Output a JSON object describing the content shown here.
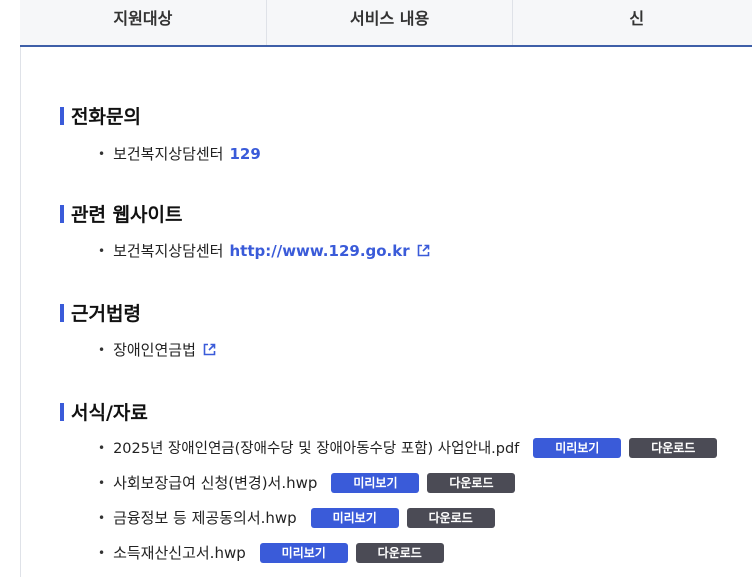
{
  "tabs": [
    "지원대상",
    "서비스 내용",
    "신"
  ],
  "sections": {
    "phone": {
      "title": "전화문의",
      "item_label": "보건복지상담센터",
      "item_value": "129"
    },
    "website": {
      "title": "관련 웹사이트",
      "item_label": "보건복지상담센터",
      "item_link": "http://www.129.go.kr",
      "item_icon": "external-link-icon"
    },
    "law": {
      "title": "근거법령",
      "item_label": "장애인연금법",
      "item_icon": "external-link-icon"
    },
    "forms": {
      "title": "서식/자료",
      "preview_label": "미리보기",
      "download_label": "다운로드",
      "files": [
        "2025년 장애인연금(장애수당 및 장애아동수당 포함) 사업안내.pdf",
        "사회보장급여 신청(변경)서.hwp",
        "금융정보 등 제공동의서.hwp",
        "소득재산신고서.hwp"
      ]
    }
  },
  "colors": {
    "accent": "#3a5bd9",
    "download_button": "#4b4b55",
    "tab_border": "#3e5fa8"
  }
}
